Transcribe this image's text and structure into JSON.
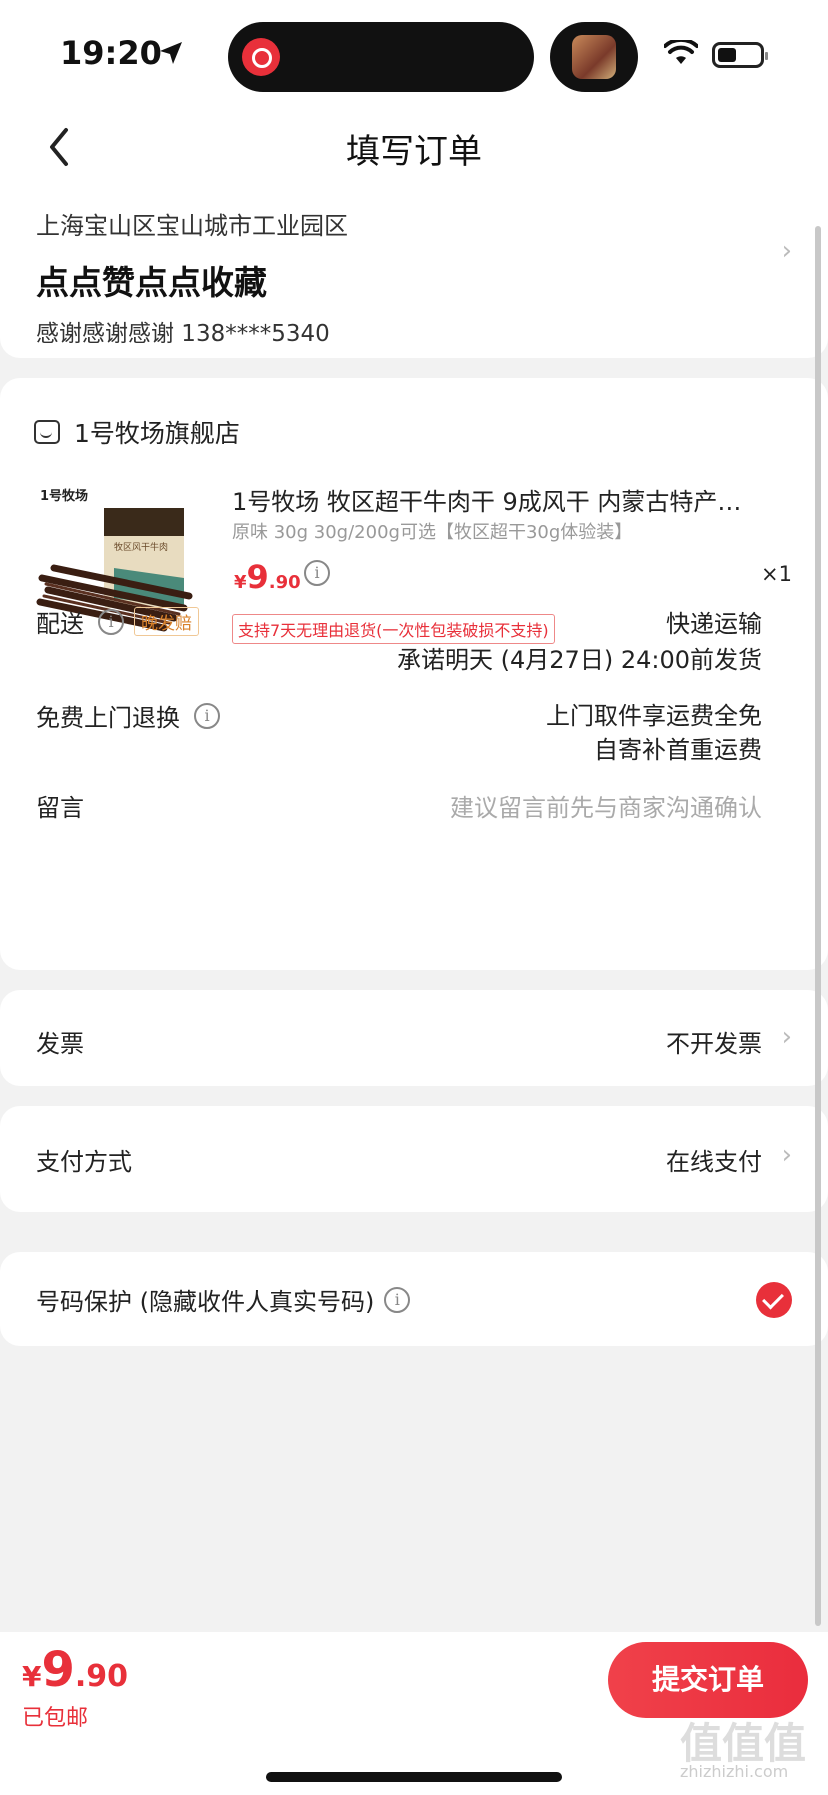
{
  "status_bar": {
    "time": "19:20"
  },
  "nav": {
    "title": "填写订单"
  },
  "address": {
    "region": "上海宝山区宝山城市工业园区",
    "name": "点点赞点点收藏",
    "contact": "感谢感谢感谢  138****5340"
  },
  "store": {
    "name": "1号牧场旗舰店",
    "product": {
      "title": "1号牧场 牧区超干牛肉干 9成风干 内蒙古特产…",
      "spec": "原味 30g 30g/200g可选【牧区超干30g体验装】",
      "price_yen": "¥",
      "price_int": "9",
      "price_dec": ".90",
      "quantity": "×1",
      "return_policy": "支持7天无理由退货(一次性包装破损不支持)",
      "brand_label": "1号牧场",
      "package_label": "牧区风干牛肉"
    },
    "delivery": {
      "label": "配送",
      "tag": "晚发赔",
      "method": "快递运输",
      "promise": "承诺明天 (4月27日) 24:00前发货"
    },
    "return": {
      "label": "免费上门退换",
      "line1": "上门取件享运费全免",
      "line2": "自寄补首重运费"
    },
    "message": {
      "label": "留言",
      "placeholder": "建议留言前先与商家沟通确认"
    }
  },
  "invoice": {
    "label": "发票",
    "value": "不开发票"
  },
  "payment": {
    "label": "支付方式",
    "value": "在线支付"
  },
  "privacy": {
    "label": "号码保护 (隐藏收件人真实号码)",
    "checked": true
  },
  "bottom": {
    "total_yen": "¥",
    "total_int": "9",
    "total_dec": ".90",
    "shipping": "已包邮",
    "submit": "提交订单"
  },
  "watermark": {
    "main": "值值值",
    "sub": "zhizhizhi.com"
  },
  "colors": {
    "accent": "#e8303a",
    "late_tag": "#d9822b"
  },
  "icons": [
    "location-arrow-icon",
    "wifi-icon",
    "battery-icon",
    "back-chevron-icon",
    "store-icon",
    "info-icon",
    "chevron-right-icon",
    "check-icon"
  ]
}
